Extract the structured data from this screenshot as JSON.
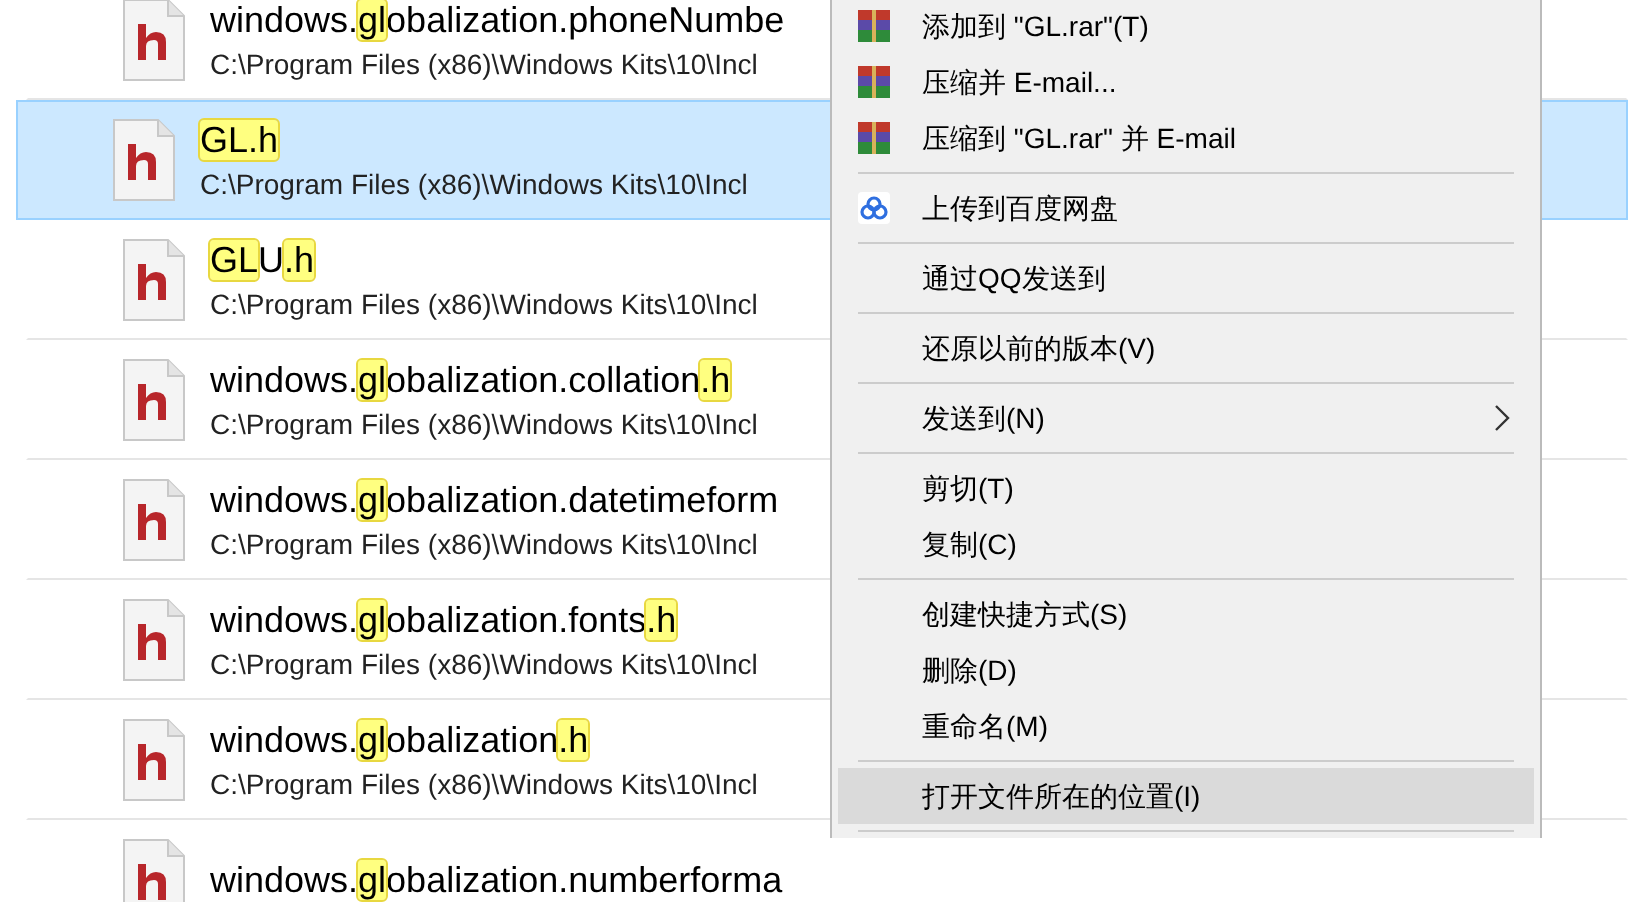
{
  "results": [
    {
      "name": [
        {
          "text": "windows.",
          "hl": false
        },
        {
          "text": "gl",
          "hl": true
        },
        {
          "text": "obalization.phoneNumbe",
          "hl": false
        }
      ],
      "path": "C:\\Program Files (x86)\\Windows Kits\\10\\Incl",
      "selected": false
    },
    {
      "name": [
        {
          "text": "GL.h",
          "hl": true
        }
      ],
      "path": "C:\\Program Files (x86)\\Windows Kits\\10\\Incl",
      "selected": true
    },
    {
      "name": [
        {
          "text": "GL",
          "hl": true
        },
        {
          "text": "U",
          "hl": false
        },
        {
          "text": ".h",
          "hl": true
        }
      ],
      "path": "C:\\Program Files (x86)\\Windows Kits\\10\\Incl",
      "selected": false
    },
    {
      "name": [
        {
          "text": "windows.",
          "hl": false
        },
        {
          "text": "gl",
          "hl": true
        },
        {
          "text": "obalization.collation",
          "hl": false
        },
        {
          "text": ".h",
          "hl": true
        }
      ],
      "path": "C:\\Program Files (x86)\\Windows Kits\\10\\Incl",
      "selected": false
    },
    {
      "name": [
        {
          "text": "windows.",
          "hl": false
        },
        {
          "text": "gl",
          "hl": true
        },
        {
          "text": "obalization.datetimeform",
          "hl": false
        }
      ],
      "path": "C:\\Program Files (x86)\\Windows Kits\\10\\Incl",
      "selected": false
    },
    {
      "name": [
        {
          "text": "windows.",
          "hl": false
        },
        {
          "text": "gl",
          "hl": true
        },
        {
          "text": "obalization.fonts",
          "hl": false
        },
        {
          "text": ".h",
          "hl": true
        }
      ],
      "path": "C:\\Program Files (x86)\\Windows Kits\\10\\Incl",
      "selected": false
    },
    {
      "name": [
        {
          "text": "windows.",
          "hl": false
        },
        {
          "text": "gl",
          "hl": true
        },
        {
          "text": "obalization",
          "hl": false
        },
        {
          "text": ".h",
          "hl": true
        }
      ],
      "path": "C:\\Program Files (x86)\\Windows Kits\\10\\Incl",
      "selected": false
    },
    {
      "name": [
        {
          "text": "windows.",
          "hl": false
        },
        {
          "text": "gl",
          "hl": true
        },
        {
          "text": "obalization.numberforma",
          "hl": false
        }
      ],
      "selected": false
    }
  ],
  "context_menu": [
    {
      "kind": "rar",
      "label": "添加到 \"GL.rar\"(T)",
      "selected": false
    },
    {
      "kind": "rar",
      "label": "压缩并 E-mail...",
      "selected": false
    },
    {
      "kind": "rar",
      "label": "压缩到 \"GL.rar\" 并 E-mail",
      "selected": false
    },
    {
      "kind": "separator"
    },
    {
      "kind": "cloud",
      "label": "上传到百度网盘",
      "selected": false
    },
    {
      "kind": "separator"
    },
    {
      "kind": "plain",
      "label": "通过QQ发送到",
      "selected": false
    },
    {
      "kind": "separator"
    },
    {
      "kind": "plain",
      "label": "还原以前的版本(V)",
      "selected": false
    },
    {
      "kind": "separator"
    },
    {
      "kind": "submenu",
      "label": "发送到(N)",
      "selected": false
    },
    {
      "kind": "separator"
    },
    {
      "kind": "plain",
      "label": "剪切(T)",
      "selected": false
    },
    {
      "kind": "plain",
      "label": "复制(C)",
      "selected": false
    },
    {
      "kind": "separator"
    },
    {
      "kind": "plain",
      "label": "创建快捷方式(S)",
      "selected": false
    },
    {
      "kind": "plain",
      "label": "删除(D)",
      "selected": false
    },
    {
      "kind": "plain",
      "label": "重命名(M)",
      "selected": false
    },
    {
      "kind": "separator"
    },
    {
      "kind": "plain",
      "label": "打开文件所在的位置(I)",
      "selected": true
    },
    {
      "kind": "separator"
    }
  ]
}
